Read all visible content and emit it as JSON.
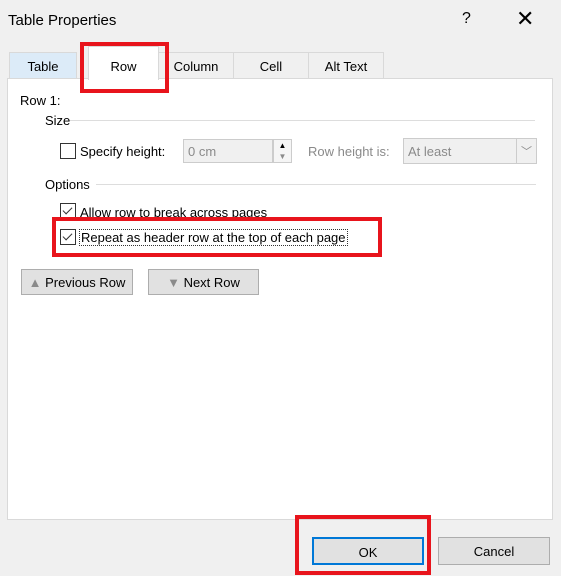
{
  "window": {
    "title": "Table Properties",
    "help": "?",
    "close": "✕"
  },
  "tabs": [
    {
      "label": "Table"
    },
    {
      "label": "Row"
    },
    {
      "label": "Column"
    },
    {
      "label": "Cell"
    },
    {
      "label": "Alt Text"
    }
  ],
  "row": {
    "heading": "Row 1:",
    "size_label": "Size",
    "specify_height_label": "Specify height:",
    "specify_height_checked": false,
    "height_value": "0 cm",
    "row_height_is_label": "Row height is:",
    "row_height_is_value": "At least",
    "options_label": "Options",
    "allow_break_label": "Allow row to break across pages",
    "allow_break_checked": true,
    "repeat_header_label": "Repeat as header row at the top of each page",
    "repeat_header_checked": true,
    "previous_row": "Previous Row",
    "next_row": "Next Row"
  },
  "footer": {
    "ok": "OK",
    "cancel": "Cancel"
  },
  "highlight_color": "#e8141c"
}
